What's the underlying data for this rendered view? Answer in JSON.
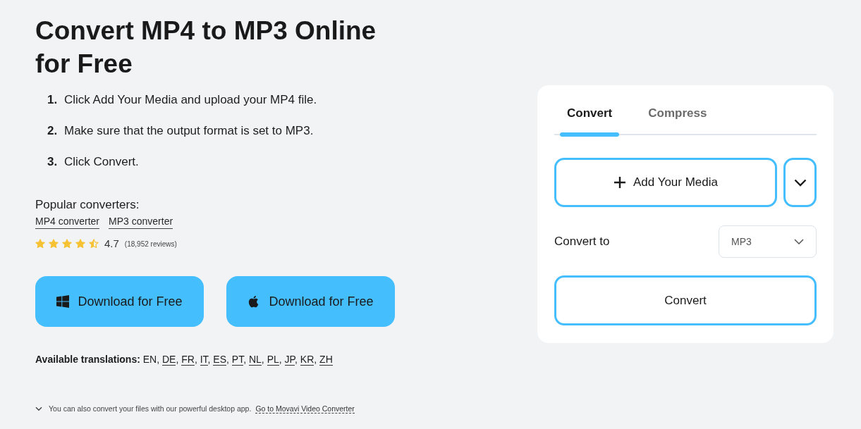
{
  "heading": "Convert MP4 to MP3 Online for Free",
  "steps": [
    {
      "number": "1.",
      "text": "Click Add Your Media and upload your MP4 file."
    },
    {
      "number": "2.",
      "text": "Make sure that the output format is set to MP3."
    },
    {
      "number": "3.",
      "text": "Click Convert."
    }
  ],
  "popular_converters": {
    "label": "Popular converters:",
    "links": [
      "MP4 converter",
      "MP3 converter"
    ]
  },
  "rating": {
    "stars": 4.5,
    "score": "4.7",
    "reviews": "(18,952 reviews)"
  },
  "download_buttons": [
    {
      "kind": "windows",
      "label": "Download for Free"
    },
    {
      "kind": "apple",
      "label": "Download for Free"
    }
  ],
  "translations": {
    "label": "Available translations:",
    "separator": ",",
    "languages": [
      {
        "code": "EN",
        "selected": true
      },
      {
        "code": "DE",
        "selected": false
      },
      {
        "code": "FR",
        "selected": false
      },
      {
        "code": "IT",
        "selected": false
      },
      {
        "code": "ES",
        "selected": false
      },
      {
        "code": "PT",
        "selected": false
      },
      {
        "code": "NL",
        "selected": false
      },
      {
        "code": "PL",
        "selected": false
      },
      {
        "code": "JP",
        "selected": false
      },
      {
        "code": "KR",
        "selected": false
      },
      {
        "code": "ZH",
        "selected": false
      }
    ]
  },
  "footer": {
    "text": "You can also convert your files with our powerful desktop app.",
    "link": "Go to Movavi Video Converter"
  },
  "converter_panel": {
    "tabs": [
      {
        "label": "Convert",
        "selected": true
      },
      {
        "label": "Compress",
        "selected": false
      }
    ],
    "add_media_button": "Add Your Media",
    "convert_to": {
      "label": "Convert to",
      "value": "MP3"
    },
    "convert_button": "Convert"
  }
}
